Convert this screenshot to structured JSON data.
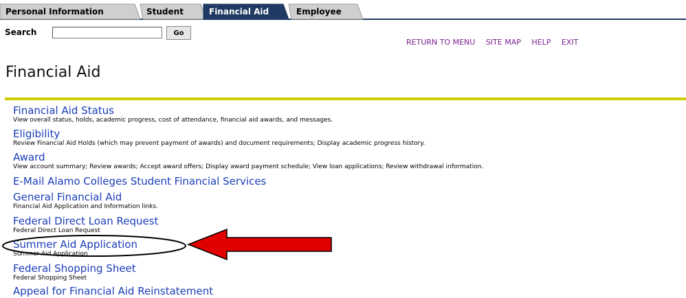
{
  "tabs": [
    {
      "label": "Personal Information",
      "active": false
    },
    {
      "label": "Student",
      "active": false
    },
    {
      "label": "Financial Aid",
      "active": true
    },
    {
      "label": "Employee",
      "active": false
    }
  ],
  "search": {
    "label": "Search",
    "button_label": "Go",
    "value": ""
  },
  "top_links": [
    "RETURN TO MENU",
    "SITE MAP",
    "HELP",
    "EXIT"
  ],
  "page_title": "Financial Aid",
  "menu": [
    {
      "label": "Financial Aid Status",
      "description": "View overall status, holds, academic progress, cost of attendance, financial aid awards, and messages."
    },
    {
      "label": "Eligibility",
      "description": "Review Financial Aid Holds (which may prevent payment of awards) and document requirements; Display academic progress history."
    },
    {
      "label": "Award",
      "description": "View account summary; Review awards; Accept award offers; Display award payment schedule; View loan applications; Review withdrawal information."
    },
    {
      "label": "E-Mail Alamo Colleges Student Financial Services",
      "description": ""
    },
    {
      "label": "General Financial Aid",
      "description": "Financial Aid Application and Information links."
    },
    {
      "label": "Federal Direct Loan Request",
      "description": "Federal Direct Loan Request"
    },
    {
      "label": "Summer Aid Application",
      "description": "Summer Aid Application"
    },
    {
      "label": "Federal Shopping Sheet",
      "description": "Federal Shopping Sheet"
    },
    {
      "label": "Appeal for Financial Aid Reinstatement",
      "description": ""
    }
  ],
  "colors": {
    "tab_inactive": "#cfcfcf",
    "tab_active": "#1f3a63",
    "link": "#1a3cb8",
    "top_link": "#7a1f8f",
    "divider": "#cccc00",
    "arrow": "#e00000"
  },
  "annotations": {
    "highlighted_item": "Summer Aid Application",
    "arrow_icon": "red-arrow-icon",
    "ellipse": "highlight-ellipse"
  }
}
